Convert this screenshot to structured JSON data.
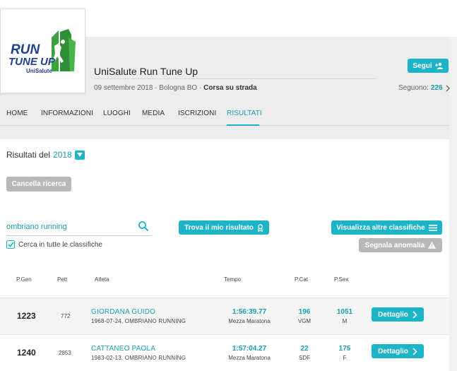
{
  "event": {
    "logo": {
      "line1": "RUN",
      "line2": "TUNE UP",
      "line3": "UniSalute"
    },
    "title": "UniSalute Run Tune Up",
    "meta_prefix": "09 settembre 2018 · Bologna BO · ",
    "meta_type": "Corsa su strada",
    "follow_label": "Segui",
    "following_label": "Seguono:",
    "following_count": "226"
  },
  "nav": {
    "items": [
      "HOME",
      "INFORMAZIONI",
      "LUOGHI",
      "MEDIA",
      "ISCRIZIONI",
      "RISULTATI"
    ],
    "active": "RISULTATI"
  },
  "results": {
    "heading": "Risultati del",
    "year": "2018",
    "cancel_label": "Cancella ricerca",
    "search_value": "ombriano running",
    "checkbox_label": "Cerca in tutte le classifiche",
    "checkbox_checked": true,
    "find_label": "Trova il mio risultato",
    "other_label": "Visualizza altre classifiche",
    "report_label": "Segnala anomalia",
    "columns": [
      "P.Gen",
      "Pett",
      "Atleta",
      "Tempo",
      "P.Cat",
      "P.Sex"
    ],
    "detail_label": "Dettaglio",
    "rows": [
      {
        "pos": "1223",
        "bib": "772",
        "name": "GIORDANA GUIDO",
        "info": "1968-07-24, OMBRIANO RUNNING",
        "time": "1:56:39.77",
        "race": "Mezza Maratona",
        "pcat": "196",
        "cat": "VGM",
        "psex": "1051",
        "sex": "M"
      },
      {
        "pos": "1240",
        "bib": "2853",
        "name": "CATTANEO PAOLA",
        "info": "1983-02-13, OMBRIANO RUNNING",
        "time": "1:57:04.27",
        "race": "Mezza Maratona",
        "pcat": "22",
        "cat": "SDF",
        "psex": "175",
        "sex": "F"
      }
    ]
  },
  "colors": {
    "accent": "#1eb4c8",
    "link": "#1a9db0",
    "logo_blue": "#1f3f8f",
    "logo_green": "#3aa43c"
  }
}
